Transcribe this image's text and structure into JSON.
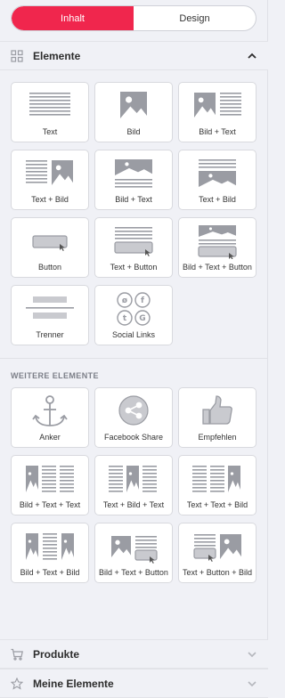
{
  "tabs": {
    "content": "Inhalt",
    "design": "Design"
  },
  "sections": {
    "elements": {
      "title": "Elemente"
    },
    "more": {
      "title": "WEITERE ELEMENTE"
    },
    "products": {
      "title": "Produkte"
    },
    "my_elements": {
      "title": "Meine Elemente"
    }
  },
  "tiles": [
    {
      "label": "Text",
      "icon": "text-block-icon"
    },
    {
      "label": "Bild",
      "icon": "image-icon"
    },
    {
      "label": "Bild + Text",
      "icon": "image-text-icon"
    },
    {
      "label": "Text + Bild",
      "icon": "text-image-icon"
    },
    {
      "label": "Bild + Text",
      "icon": "image-above-text-icon"
    },
    {
      "label": "Text + Bild",
      "icon": "text-above-image-icon"
    },
    {
      "label": "Button",
      "icon": "button-icon"
    },
    {
      "label": "Text + Button",
      "icon": "text-button-icon"
    },
    {
      "label": "Bild + Text + Button",
      "icon": "image-text-button-icon"
    },
    {
      "label": "Trenner",
      "icon": "divider-icon"
    },
    {
      "label": "Social Links",
      "icon": "social-links-icon"
    }
  ],
  "more_tiles": [
    {
      "label": "Anker",
      "icon": "anchor-icon"
    },
    {
      "label": "Facebook Share",
      "icon": "share-icon"
    },
    {
      "label": "Empfehlen",
      "icon": "thumbs-up-icon"
    },
    {
      "label": "Bild + Text + Text",
      "icon": "image-text-text-icon"
    },
    {
      "label": "Text + Bild + Text",
      "icon": "text-image-text-icon"
    },
    {
      "label": "Text + Text + Bild",
      "icon": "text-text-image-icon"
    },
    {
      "label": "Bild + Text + Bild",
      "icon": "image-text-image-icon"
    },
    {
      "label": "Bild + Text + Button",
      "icon": "image-text-button-2-icon"
    },
    {
      "label": "Text + Button + Bild",
      "icon": "text-button-image-icon"
    }
  ],
  "colors": {
    "accent": "#f0264d",
    "glyph": "#9a9ca3",
    "glyph_light": "#c9cacf"
  }
}
